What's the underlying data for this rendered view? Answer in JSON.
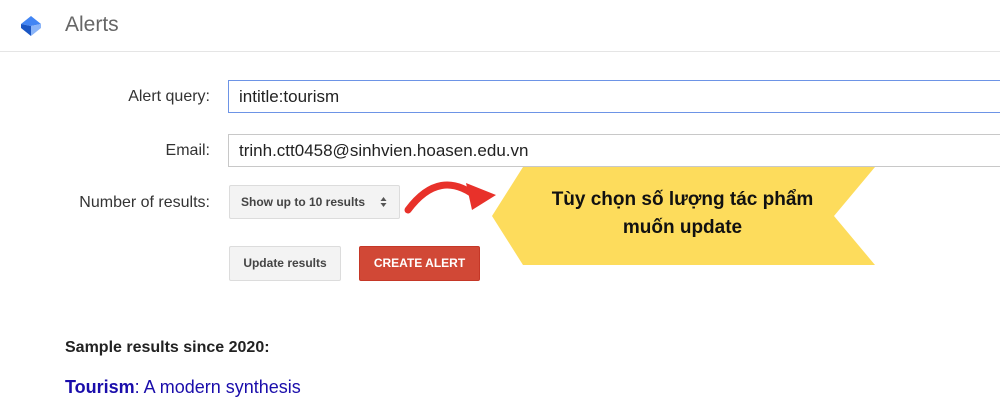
{
  "header": {
    "title": "Alerts"
  },
  "form": {
    "query_label": "Alert query:",
    "query_value": "intitle:tourism",
    "email_label": "Email:",
    "email_value": "trinh.ctt0458@sinhvien.hoasen.edu.vn",
    "results_label": "Number of results:",
    "results_selected": "Show up to 10 results",
    "update_button": "Update results",
    "create_button": "CREATE ALERT"
  },
  "annotation": {
    "line1": "Tùy chọn số lượng tác phẩm",
    "line2": "muốn update",
    "arrow_color": "#e8312a",
    "callout_color": "#fddc5c"
  },
  "samples": {
    "heading": "Sample results since 2020:",
    "first_result_highlight": "Tourism",
    "first_result_rest": ": A modern synthesis"
  },
  "colors": {
    "accent_blue": "#4285f4",
    "create_red": "#d14836",
    "link_blue": "#1a0dab"
  }
}
